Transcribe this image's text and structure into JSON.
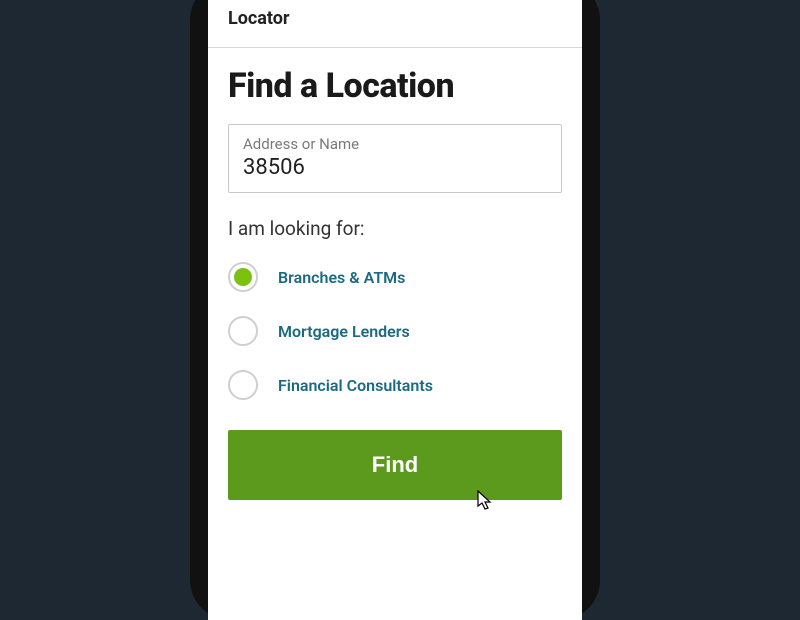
{
  "header": {
    "title": "Locator"
  },
  "page": {
    "title": "Find a Location"
  },
  "search": {
    "label": "Address or Name",
    "value": "38506"
  },
  "lookup": {
    "prompt": "I am looking for:",
    "options": [
      {
        "label": "Branches & ATMs",
        "selected": true
      },
      {
        "label": "Mortgage Lenders",
        "selected": false
      },
      {
        "label": "Financial Consultants",
        "selected": false
      }
    ]
  },
  "actions": {
    "find": "Find"
  }
}
